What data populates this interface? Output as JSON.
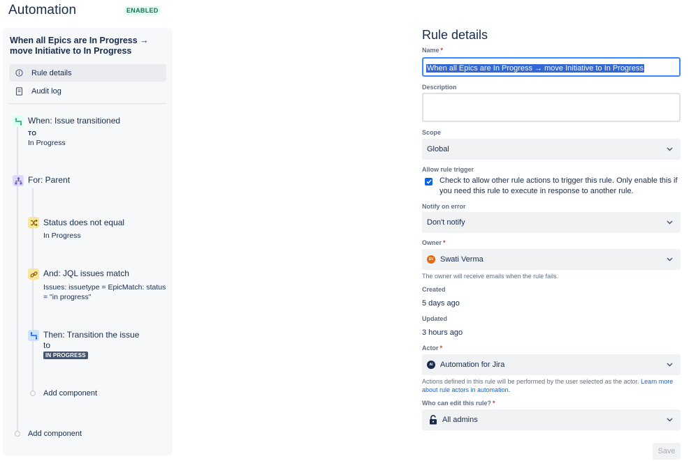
{
  "header": {
    "title": "Automation",
    "status_badge": "ENABLED"
  },
  "sidebar": {
    "rule_title": "When all Epics are In Progress → move Initiative to In Progress",
    "nav": [
      {
        "label": "Rule details",
        "icon": "info-icon",
        "active": true
      },
      {
        "label": "Audit log",
        "icon": "document-icon",
        "active": false
      }
    ],
    "components": {
      "trigger": {
        "title": "When: Issue transitioned",
        "to_label": "TO",
        "to_value": "In Progress",
        "icon": "transition-icon",
        "color": "#22a06b"
      },
      "branch": {
        "title": "For: Parent",
        "icon": "hierarchy-icon",
        "color": "#6e5dc6"
      },
      "condition1": {
        "title": "Status does not equal",
        "subtitle": "In Progress",
        "icon": "shuffle-icon",
        "color": "#f5cd47"
      },
      "condition2": {
        "title": "And: JQL issues match",
        "subtitle": "Issues: issuetype = EpicMatch: status = \"in progress\"",
        "icon": "link-icon",
        "color": "#f5cd47"
      },
      "action": {
        "title": "Then: Transition the issue to",
        "lozenge": "IN PROGRESS",
        "icon": "transition-icon",
        "color": "#579dff"
      }
    },
    "add_component_inner": "Add component",
    "add_component_outer": "Add component"
  },
  "form": {
    "heading": "Rule details",
    "name": {
      "label": "Name",
      "value": "When all Epics are In Progress → move Initiative to In Progress"
    },
    "description": {
      "label": "Description",
      "value": ""
    },
    "scope": {
      "label": "Scope",
      "value": "Global"
    },
    "allow_trigger": {
      "label": "Allow rule trigger",
      "checked": true,
      "text": "Check to allow other rule actions to trigger this rule. Only enable this if you need this rule to execute in response to another rule."
    },
    "notify": {
      "label": "Notify on error",
      "value": "Don't notify"
    },
    "owner": {
      "label": "Owner",
      "value": "Swati Verma",
      "avatar_initials": "SV",
      "avatar_color": "#e56910",
      "help": "The owner will receive emails when the rule fails."
    },
    "created": {
      "label": "Created",
      "value": "5 days ago"
    },
    "updated": {
      "label": "Updated",
      "value": "3 hours ago"
    },
    "actor": {
      "label": "Actor",
      "value": "Automation for Jira",
      "avatar_initials": "AI",
      "avatar_color": "#172b4d",
      "help_prefix": "Actions defined in this rule will be performed by the user selected as the actor. ",
      "help_link": "Learn more about rule actors in automation."
    },
    "editors": {
      "label": "Who can edit this rule?",
      "value": "All admins",
      "icon": "unlock-icon"
    },
    "save_label": "Save"
  },
  "colors": {
    "accent": "#0c66e4",
    "badge_bg": "#dcfff1",
    "badge_text": "#216e4e"
  }
}
